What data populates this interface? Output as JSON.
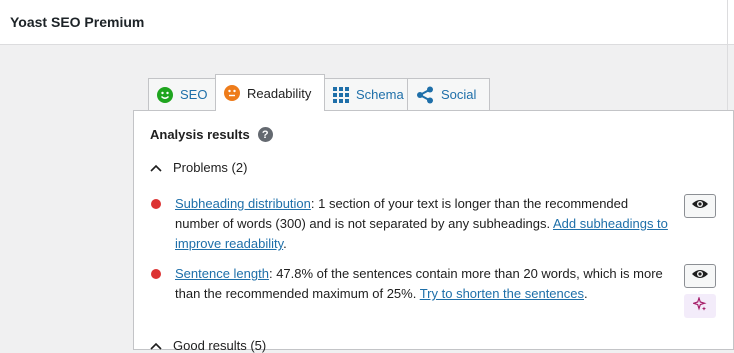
{
  "header": {
    "title": "Yoast SEO Premium"
  },
  "tabs": [
    {
      "label": "SEO",
      "icon": "smiley-green-icon"
    },
    {
      "label": "Readability",
      "icon": "neutral-face-orange-icon",
      "active": true
    },
    {
      "label": "Schema",
      "icon": "grid-icon"
    },
    {
      "label": "Social",
      "icon": "share-icon"
    }
  ],
  "analysis": {
    "heading": "Analysis results",
    "help_glyph": "?",
    "problems_label": "Problems (2)",
    "good_label": "Good results (5)",
    "items": [
      {
        "link": "Subheading distribution",
        "text": ": 1 section of your text is longer than the recommended number of words (300) and is not separated by any subheadings. ",
        "action": "Add subheadings to improve readability",
        "tail": ".",
        "status_color": "#dc3232"
      },
      {
        "link": "Sentence length",
        "text": ": 47.8% of the sentences contain more than 20 words, which is more than the recommended maximum of 25%. ",
        "action": "Try to shorten the sentences",
        "tail": ".",
        "status_color": "#dc3232"
      }
    ]
  },
  "colors": {
    "link": "#1e6fa9",
    "problem": "#dc3232",
    "seo_icon": "#1fa51f",
    "readability_icon": "#ee7c1b",
    "ai_icon": "#a61e69"
  }
}
